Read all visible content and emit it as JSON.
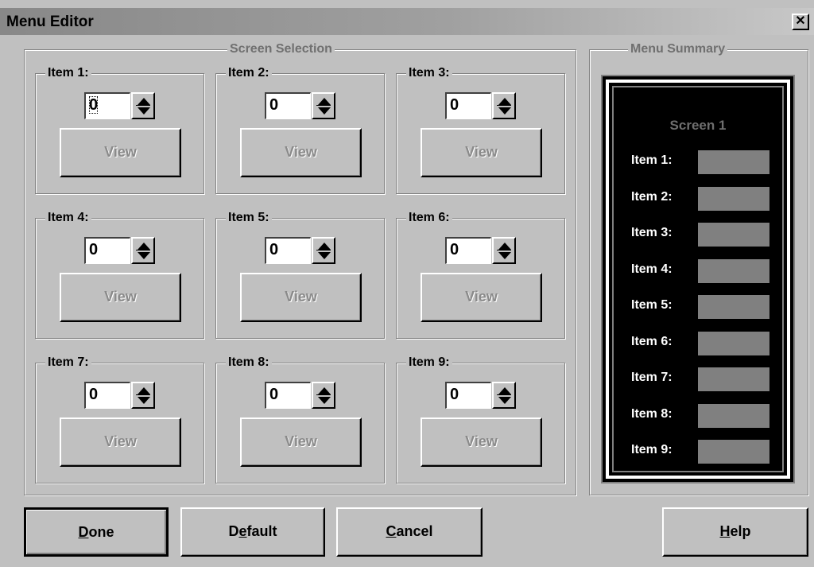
{
  "window": {
    "title": "Menu Editor",
    "close_glyph": "✕"
  },
  "screen_selection": {
    "label": "Screen Selection",
    "items": [
      {
        "label": "Item 1:",
        "value": "0",
        "view_label": "View"
      },
      {
        "label": "Item 2:",
        "value": "0",
        "view_label": "View"
      },
      {
        "label": "Item 3:",
        "value": "0",
        "view_label": "View"
      },
      {
        "label": "Item 4:",
        "value": "0",
        "view_label": "View"
      },
      {
        "label": "Item 5:",
        "value": "0",
        "view_label": "View"
      },
      {
        "label": "Item 6:",
        "value": "0",
        "view_label": "View"
      },
      {
        "label": "Item 7:",
        "value": "0",
        "view_label": "View"
      },
      {
        "label": "Item 8:",
        "value": "0",
        "view_label": "View"
      },
      {
        "label": "Item 9:",
        "value": "0",
        "view_label": "View"
      }
    ]
  },
  "menu_summary": {
    "label": "Menu Summary",
    "screen_title": "Screen 1",
    "items": [
      "Item 1:",
      "Item 2:",
      "Item 3:",
      "Item 4:",
      "Item 5:",
      "Item 6:",
      "Item 7:",
      "Item 8:",
      "Item 9:"
    ]
  },
  "buttons": {
    "done": {
      "mnemonic": "D",
      "rest": "one"
    },
    "default": {
      "pre": "D",
      "mnemonic": "e",
      "rest": "fault"
    },
    "cancel": {
      "mnemonic": "C",
      "rest": "ancel"
    },
    "help": {
      "mnemonic": "H",
      "rest": "elp"
    }
  },
  "colors": {
    "face": "#c0c0c0",
    "shadow": "#808080",
    "summary_bg": "#000000",
    "disabled_text": "#8a8a8a"
  },
  "icons": [
    "close-icon",
    "spin-up-icon",
    "spin-down-icon"
  ]
}
